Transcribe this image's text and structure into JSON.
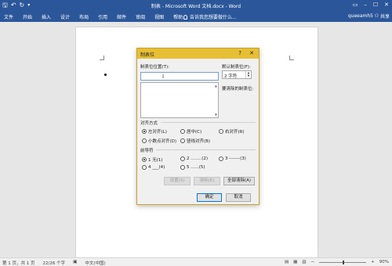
{
  "window": {
    "title": "制表 - Microsoft Word 文档.docx - Word",
    "user": "queeamh5",
    "share_label": "共享",
    "tell_me": "告诉我您想要做什么..."
  },
  "ribbon_tabs": [
    "文件",
    "开始",
    "插入",
    "设计",
    "布局",
    "引用",
    "邮件",
    "审阅",
    "视图",
    "帮助"
  ],
  "dialog": {
    "title": "制表位",
    "help": "?",
    "close": "✕",
    "tab_position_label": "制表位位置(T):",
    "default_tab_label": "默认制表位(F):",
    "default_tab_value": "2 字符",
    "to_clear_label": "要清除的制表位:",
    "alignment": {
      "label": "对齐方式",
      "options": [
        "左对齐(L)",
        "居中(C)",
        "右对齐(R)",
        "小数点对齐(D)",
        "竖线对齐(B)"
      ],
      "selected": "左对齐(L)"
    },
    "leader": {
      "label": "前导符",
      "options": [
        "1 无(1)",
        "2 ........(2)",
        "3 -------(3)",
        "4 ___(4)",
        "5 ......(5)"
      ],
      "selected": "1 无(1)"
    },
    "buttons": {
      "set": "设置(S)",
      "clear": "清除(E)",
      "clear_all": "全部清除(A)",
      "ok": "确定",
      "cancel": "取消"
    }
  },
  "status": {
    "page": "第 1 页，共 1 页",
    "words": "22/26 个字",
    "language": "中文(中国)",
    "zoom": "90%"
  }
}
